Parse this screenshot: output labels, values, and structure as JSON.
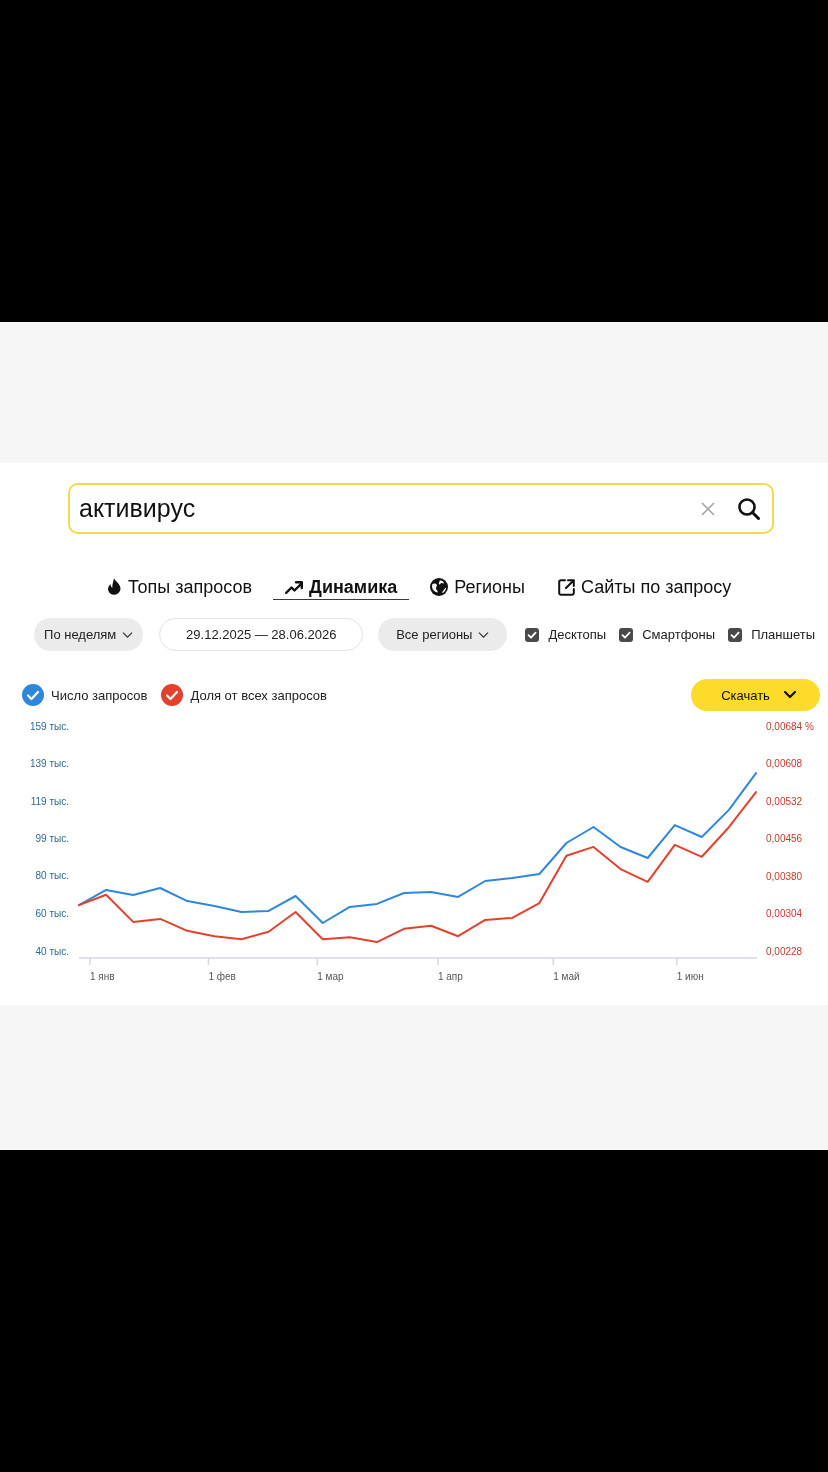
{
  "search": {
    "value": "активирус"
  },
  "tabs": [
    {
      "label": "Топы запросов",
      "selected": false
    },
    {
      "label": "Динамика",
      "selected": true
    },
    {
      "label": "Регионы",
      "selected": false
    },
    {
      "label": "Сайты по запросу",
      "selected": false
    }
  ],
  "filters": {
    "period": "По неделям",
    "date_range": "29.12.2025 — 28.06.2026",
    "region": "Все регионы",
    "devices": [
      {
        "label": "Десктопы",
        "checked": true
      },
      {
        "label": "Смартфоны",
        "checked": true
      },
      {
        "label": "Планшеты",
        "checked": true
      }
    ]
  },
  "chart": {
    "legend": [
      {
        "checked": true
      },
      {
        "checked": true
      }
    ],
    "download_button": {
      "label": "Скачать"
    },
    "chart_data": {
      "type": "line",
      "categories": [
        null,
        null,
        null,
        null,
        null,
        null,
        "1 янв",
        null,
        null,
        null,
        null,
        null,
        null,
        null,
        null,
        null,
        null,
        null,
        null,
        null,
        null,
        null,
        null,
        null,
        null,
        null,
        null,
        null,
        null,
        null,
        null,
        null,
        null,
        null,
        null,
        null,
        null,
        "1 фев",
        null,
        null,
        null,
        null,
        null,
        null,
        null,
        null,
        null,
        null,
        null,
        null,
        null,
        null,
        null,
        null,
        null,
        null,
        null,
        null,
        null,
        null,
        null,
        null,
        null,
        null,
        null,
        "1 мар",
        null,
        null,
        null,
        null,
        null,
        null,
        null,
        null,
        null,
        null,
        null,
        null,
        null,
        null,
        null,
        null,
        null,
        null,
        null,
        null,
        null,
        null,
        null,
        null,
        null,
        null,
        null,
        null,
        null,
        null,
        "1 апр",
        null,
        null,
        null,
        null,
        null,
        null,
        null,
        null,
        null,
        null,
        null,
        null,
        null,
        null,
        null,
        null,
        null,
        null,
        null,
        null,
        null,
        null,
        null,
        null,
        null,
        null,
        null,
        null,
        null,
        "1 май",
        null,
        null,
        null,
        null,
        null,
        null,
        null,
        null,
        null,
        null,
        null,
        null,
        null,
        null,
        null,
        null,
        null,
        null,
        null,
        null,
        null,
        null,
        null,
        null,
        null,
        null,
        null,
        null,
        null,
        null,
        null,
        "1 июн",
        null,
        null,
        null,
        null,
        null,
        null,
        null,
        null,
        null,
        null,
        null,
        null,
        null,
        null,
        null,
        null,
        null
      ],
      "ylim": [
        40,
        159
      ],
      "yticks": [
        {
          "value": 40,
          "label": "40 тыс."
        },
        {
          "value": 59.83,
          "label": "60 тыс."
        },
        {
          "value": 79.67,
          "label": "80 тыс."
        },
        {
          "value": 99.5,
          "label": "99 тыс."
        },
        {
          "value": 119.33,
          "label": "119 тыс."
        },
        {
          "value": 139.17,
          "label": "139 тыс."
        },
        {
          "value": 159,
          "label": "159 тыс."
        }
      ],
      "y2lim": [
        0.00228,
        0.00684
      ],
      "y2ticks": [
        {
          "value": 0.00228,
          "label": "0,00228"
        },
        {
          "value": 0.00304,
          "label": "0,00304"
        },
        {
          "value": 0.0038,
          "label": "0,00380"
        },
        {
          "value": 0.00456,
          "label": "0,00456"
        },
        {
          "value": 0.00532,
          "label": "0,00532"
        },
        {
          "value": 0.00608,
          "label": "0,00608"
        },
        {
          "value": 0.00684,
          "label": "0,00684 %"
        }
      ],
      "series": [
        {
          "name": "Число запросов",
          "color": "#2f87dc",
          "values": [
            64.3,
            null,
            null,
            null,
            null,
            null,
            null,
            72.3,
            null,
            null,
            null,
            null,
            null,
            null,
            69.6,
            null,
            null,
            null,
            null,
            null,
            null,
            73.3,
            null,
            null,
            null,
            null,
            null,
            null,
            66.4,
            null,
            null,
            null,
            null,
            null,
            null,
            63.8,
            null,
            null,
            null,
            null,
            null,
            null,
            60.6,
            null,
            null,
            null,
            null,
            null,
            null,
            61.2,
            null,
            null,
            null,
            null,
            null,
            null,
            69.1,
            null,
            null,
            null,
            null,
            null,
            null,
            54.8,
            null,
            null,
            null,
            null,
            null,
            null,
            63.3,
            null,
            null,
            null,
            null,
            null,
            null,
            64.9,
            null,
            null,
            null,
            null,
            null,
            null,
            70.7,
            null,
            null,
            null,
            null,
            null,
            null,
            71.2,
            null,
            null,
            null,
            null,
            null,
            null,
            68.6,
            null,
            null,
            null,
            null,
            null,
            null,
            77.0,
            null,
            null,
            null,
            null,
            null,
            null,
            78.6,
            null,
            null,
            null,
            null,
            null,
            null,
            80.7,
            null,
            null,
            null,
            null,
            null,
            null,
            97.1,
            null,
            null,
            null,
            null,
            null,
            null,
            105.6,
            null,
            null,
            null,
            null,
            null,
            null,
            95.0,
            null,
            null,
            null,
            null,
            null,
            null,
            89.2,
            null,
            null,
            null,
            null,
            null,
            null,
            106.6,
            null,
            null,
            null,
            null,
            null,
            null,
            100.3,
            null,
            null,
            null,
            null,
            null,
            null,
            114.6,
            null,
            null,
            null,
            null,
            null,
            null,
            134.1
          ]
        },
        {
          "name": "Доля от всех запросов",
          "color": "#e2412c",
          "axis": "y2",
          "values": [
            0.00321,
            null,
            null,
            null,
            null,
            null,
            null,
            0.00342,
            null,
            null,
            null,
            null,
            null,
            null,
            0.00287,
            null,
            null,
            null,
            null,
            null,
            null,
            0.00293,
            null,
            null,
            null,
            null,
            null,
            null,
            0.00269,
            null,
            null,
            null,
            null,
            null,
            null,
            0.00258,
            null,
            null,
            null,
            null,
            null,
            null,
            0.00252,
            null,
            null,
            null,
            null,
            null,
            null,
            0.00267,
            null,
            null,
            null,
            null,
            null,
            null,
            0.00307,
            null,
            null,
            null,
            null,
            null,
            null,
            0.00252,
            null,
            null,
            null,
            null,
            null,
            null,
            0.00256,
            null,
            null,
            null,
            null,
            null,
            null,
            0.00246,
            null,
            null,
            null,
            null,
            null,
            null,
            0.00273,
            null,
            null,
            null,
            null,
            null,
            null,
            0.00279,
            null,
            null,
            null,
            null,
            null,
            null,
            0.00258,
            null,
            null,
            null,
            null,
            null,
            null,
            0.00291,
            null,
            null,
            null,
            null,
            null,
            null,
            0.00295,
            null,
            null,
            null,
            null,
            null,
            null,
            0.00325,
            null,
            null,
            null,
            null,
            null,
            null,
            0.00421,
            null,
            null,
            null,
            null,
            null,
            null,
            0.00439,
            null,
            null,
            null,
            null,
            null,
            null,
            0.00394,
            null,
            null,
            null,
            null,
            null,
            null,
            0.00368,
            null,
            null,
            null,
            null,
            null,
            null,
            0.00443,
            null,
            null,
            null,
            null,
            null,
            null,
            0.00419,
            null,
            null,
            null,
            null,
            null,
            null,
            0.00479,
            null,
            null,
            null,
            null,
            null,
            null,
            0.0055
          ]
        }
      ]
    }
  }
}
